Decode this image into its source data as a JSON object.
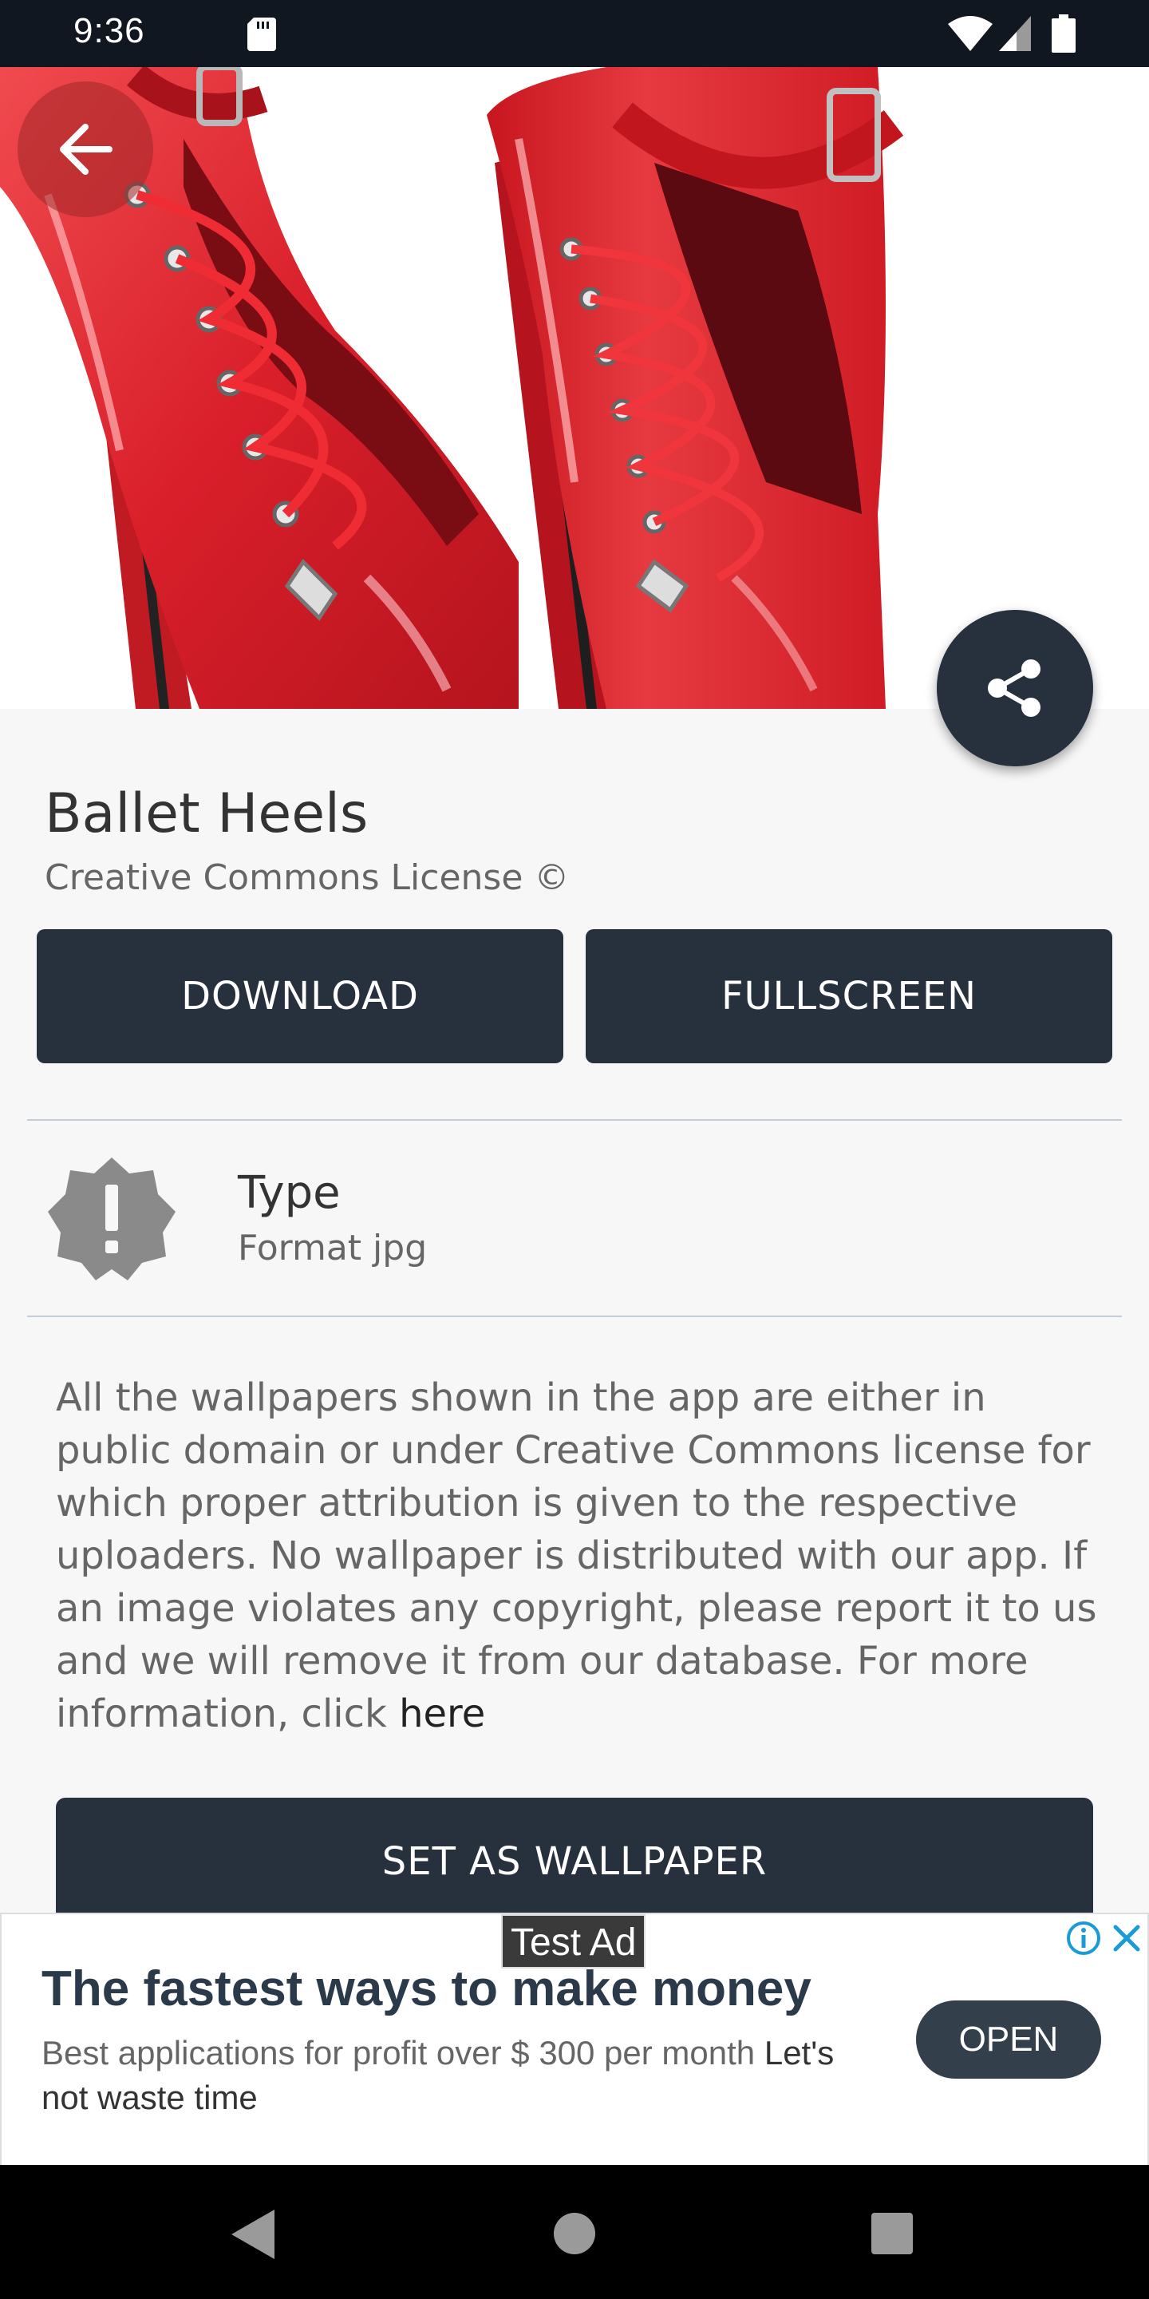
{
  "status_bar": {
    "time": "9:36",
    "icons": [
      "sd-card-icon",
      "wifi-icon",
      "signal-icon",
      "battery-icon"
    ]
  },
  "hero": {
    "description_icon": "back-arrow-icon",
    "share_icon": "share-icon"
  },
  "wallpaper": {
    "title": "Ballet Heels",
    "license": "Creative Commons License ©"
  },
  "actions": {
    "download_label": "DOWNLOAD",
    "fullscreen_label": "FULLSCREEN"
  },
  "type_info": {
    "label": "Type",
    "value": "Format jpg",
    "icon": "alert-badge-icon"
  },
  "disclaimer": {
    "text": "All the wallpapers shown in the app are either in public domain or under Creative Commons license for which proper attribution is given to the respective uploaders. No wallpaper is distributed with our app. If an image violates any copyright, please report it to us and we will remove it from our database. For more information, click ",
    "link_text": "here"
  },
  "set_wallpaper_label": "SET AS WALLPAPER",
  "ad": {
    "badge": "Test Ad",
    "headline": "The fastest ways to make money",
    "body": "Best applications for profit over $ 300 per month ",
    "body_emphasis": "Let's not waste time",
    "cta": "OPEN"
  },
  "colors": {
    "primary_dark": "#27313d",
    "shoe_red": "#d91f2a",
    "background": "#f7f7f7"
  }
}
